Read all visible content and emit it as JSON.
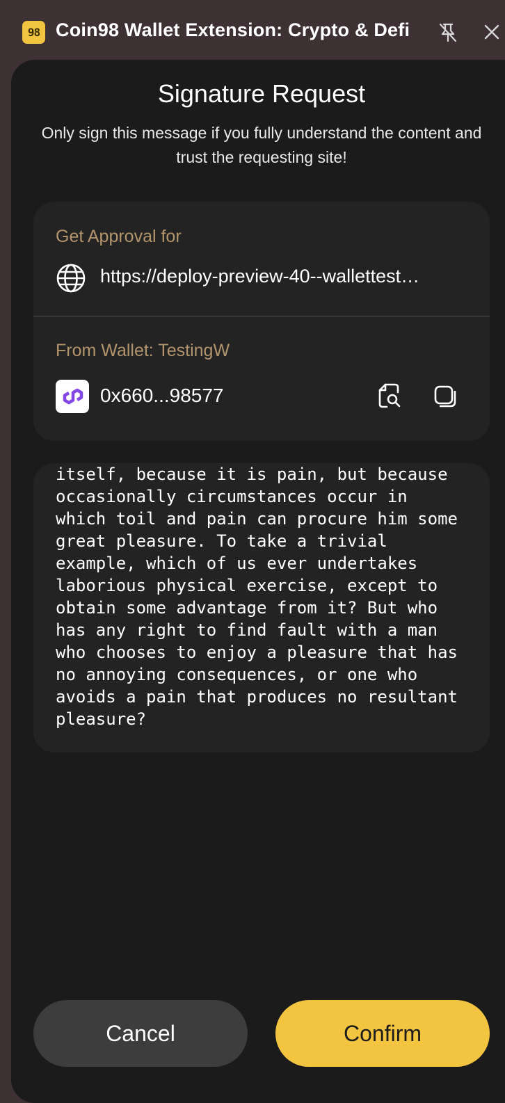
{
  "window": {
    "logo_text": "98",
    "title": "Coin98 Wallet Extension: Crypto & Defi",
    "icons": {
      "pin": "unpin-icon",
      "close": "close-icon"
    }
  },
  "request": {
    "heading": "Signature Request",
    "subtitle": "Only sign this message if you fully understand the content and trust the requesting site!"
  },
  "approval": {
    "label": "Get Approval for",
    "url": "https://deploy-preview-40--wallettest…",
    "icon": "globe-icon"
  },
  "wallet": {
    "label": "From Wallet: TestingW",
    "address": "0x660...98577",
    "icon": "polygon-logo-icon",
    "actions": {
      "explore": "search-document-icon",
      "copy": "copy-icon"
    }
  },
  "message": {
    "text": "itself, because it is pain, but because\noccasionally circumstances occur in\nwhich toil and pain can procure him some\ngreat pleasure. To take a trivial\nexample, which of us ever undertakes\nlaborious physical exercise, except to\nobtain some advantage from it? But who\nhas any right to find fault with a man\nwho chooses to enjoy a pleasure that has\nno annoying consequences, or one who\navoids a pain that produces no resultant\npleasure?"
  },
  "actions": {
    "cancel_label": "Cancel",
    "confirm_label": "Confirm"
  },
  "colors": {
    "accent": "#f3c43f",
    "label_gold": "#b3956d",
    "panel_bg": "#1b1b1b",
    "card_bg": "#232323",
    "window_bg": "#3e3134",
    "polygon_purple": "#8247e5"
  }
}
